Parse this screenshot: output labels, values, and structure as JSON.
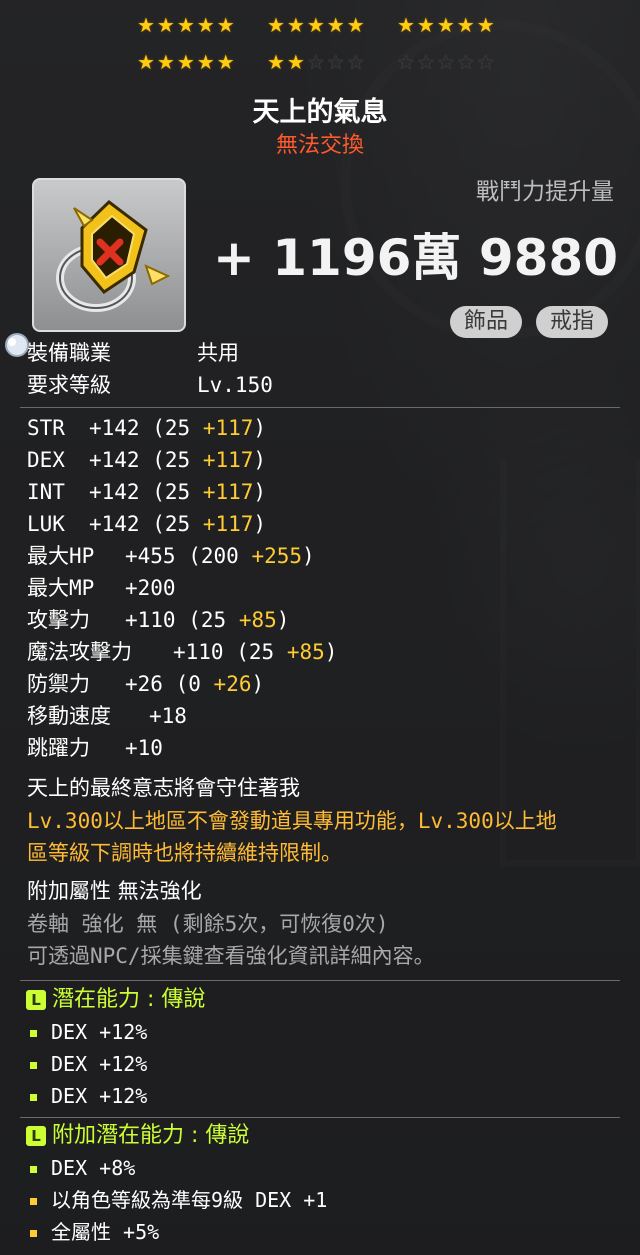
{
  "stars": {
    "row1": [
      5,
      5,
      5
    ],
    "row2_filled": [
      5,
      2,
      0
    ],
    "per_group": 5
  },
  "item": {
    "name": "天上的氣息",
    "trade_status": "無法交換",
    "icon": "ring-icon"
  },
  "combat_power": {
    "label": "戰鬥力提升量",
    "value": "+ 1196萬 9880"
  },
  "tags": [
    "飾品",
    "戒指"
  ],
  "requirements": [
    {
      "label": "裝備職業",
      "value": "共用"
    },
    {
      "label": "要求等級",
      "value": "Lv.150"
    }
  ],
  "stats": [
    {
      "label": "STR",
      "total": "+142",
      "base": "(25",
      "bonus": "+117",
      "close": ")"
    },
    {
      "label": "DEX",
      "total": "+142",
      "base": "(25",
      "bonus": "+117",
      "close": ")"
    },
    {
      "label": "INT",
      "total": "+142",
      "base": "(25",
      "bonus": "+117",
      "close": ")"
    },
    {
      "label": "LUK",
      "total": "+142",
      "base": "(25",
      "bonus": "+117",
      "close": ")"
    },
    {
      "label": "最大HP",
      "total": "+455",
      "base": "(200",
      "bonus": "+255",
      "close": ")"
    },
    {
      "label": "最大MP",
      "total": "+200",
      "base": "",
      "bonus": "",
      "close": ""
    },
    {
      "label": "攻擊力",
      "total": "+110",
      "base": "(25",
      "bonus": "+85",
      "close": ")"
    },
    {
      "label": "魔法攻擊力",
      "total": "+110",
      "base": "(25",
      "bonus": "+85",
      "close": ")"
    },
    {
      "label": "防禦力",
      "total": "+26",
      "base": "(0",
      "bonus": "+26",
      "close": ")"
    },
    {
      "label": "移動速度",
      "total": "+18",
      "base": "",
      "bonus": "",
      "close": ""
    },
    {
      "label": "跳躍力",
      "total": "+10",
      "base": "",
      "bonus": "",
      "close": ""
    }
  ],
  "description": {
    "flavor": "天上的最終意志將會守住著我",
    "restriction_line1": "Lv.300以上地區不會發動道具專用功能，Lv.300以上地",
    "restriction_line2": "區等級下調時也將持續維持限制。"
  },
  "enhance": {
    "line1": "附加屬性 無法強化",
    "line2": "卷軸 強化 無 (剩餘5次，可恢復0次)",
    "line3": "可透過NPC/採集鍵查看強化資訊詳細內容。"
  },
  "potential": {
    "header": "潛在能力 : 傳說",
    "badge": "L",
    "lines": [
      "DEX +12%",
      "DEX +12%",
      "DEX +12%"
    ]
  },
  "additional_potential": {
    "header": "附加潛在能力 : 傳說",
    "badge": "L",
    "lines": [
      "DEX +8%",
      "以角色等級為準每9級 DEX +1",
      "全屬性 +5%"
    ]
  },
  "colors": {
    "star_on": "#ffcc11",
    "trade_red": "#ff5a2b",
    "bonus_gold": "#ffcc33",
    "legendary_green": "#ccff33"
  }
}
